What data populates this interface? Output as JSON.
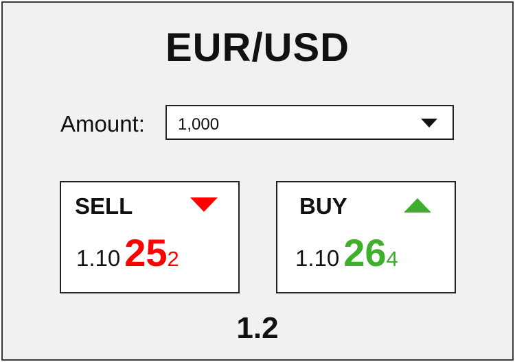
{
  "title": "EUR/USD",
  "amount": {
    "label": "Amount:",
    "value": "1,000"
  },
  "sell": {
    "label": "SELL",
    "direction_icon": "triangle-down-icon",
    "price_prefix": "1.10",
    "price_big": "25",
    "price_small": "2",
    "color": "#ff0000"
  },
  "buy": {
    "label": "BUY",
    "direction_icon": "triangle-up-icon",
    "price_prefix": "1.10",
    "price_big": "26",
    "price_small": "4",
    "color": "#3fae2a"
  },
  "spread": "1.2"
}
